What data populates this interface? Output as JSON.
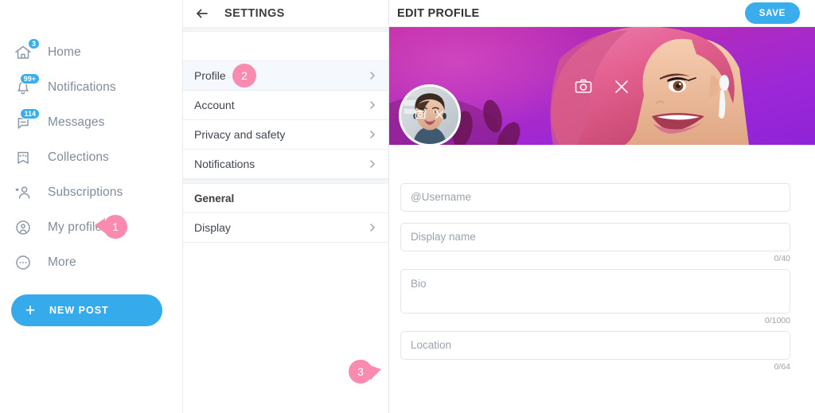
{
  "sidebar": {
    "items": [
      {
        "label": "Home",
        "icon": "home-icon",
        "badge": "3"
      },
      {
        "label": "Notifications",
        "icon": "bell-icon",
        "badge": "99+"
      },
      {
        "label": "Messages",
        "icon": "message-icon",
        "badge": "114"
      },
      {
        "label": "Collections",
        "icon": "bookmark-star-icon",
        "badge": ""
      },
      {
        "label": "Subscriptions",
        "icon": "person-heart-icon",
        "badge": ""
      },
      {
        "label": "My profile",
        "icon": "person-circle-icon",
        "badge": ""
      },
      {
        "label": "More",
        "icon": "dots-circle-icon",
        "badge": ""
      }
    ],
    "new_post_label": "NEW POST",
    "new_post_icon": "plus-icon",
    "badge_color": "#3aaeec",
    "button_color": "#36abec"
  },
  "settings": {
    "title": "SETTINGS",
    "back_icon": "arrow-left-icon",
    "chevron_icon": "chevron-right-icon",
    "rows": [
      {
        "label": "Profile",
        "active": true
      },
      {
        "label": "Account",
        "active": false
      },
      {
        "label": "Privacy and safety",
        "active": false
      },
      {
        "label": "Notifications",
        "active": false
      }
    ],
    "group_label": "General",
    "group_rows": [
      {
        "label": "Display",
        "active": false
      }
    ]
  },
  "editor": {
    "title": "EDIT PROFILE",
    "save_label": "SAVE",
    "save_color": "#3aaeec",
    "cover": {
      "name": "cover-photo",
      "camera_icon": "camera-icon",
      "remove_icon": "close-icon",
      "dominant_color": "#9b27d6",
      "accent_color": "#cf2fa8"
    },
    "avatar": {
      "name": "avatar-photo",
      "camera_icon": "camera-icon",
      "remove_icon": "close-icon"
    },
    "fields": [
      {
        "name": "username-input",
        "placeholder": "@Username",
        "value": "",
        "counter": ""
      },
      {
        "name": "display-name-input",
        "placeholder": "Display name",
        "value": "",
        "counter": "0/40"
      },
      {
        "name": "bio-input",
        "placeholder": "Bio",
        "value": "",
        "counter": "0/1000"
      },
      {
        "name": "location-input",
        "placeholder": "Location",
        "value": "",
        "counter": "0/64"
      }
    ]
  },
  "markers": [
    {
      "number": "1",
      "target": "my-profile"
    },
    {
      "number": "2",
      "target": "profile-settings-row"
    },
    {
      "number": "3",
      "target": "settings-panel-empty-area"
    }
  ],
  "colors": {
    "marker_pink": "#f98bb0",
    "active_row": "#f5f9fe"
  }
}
